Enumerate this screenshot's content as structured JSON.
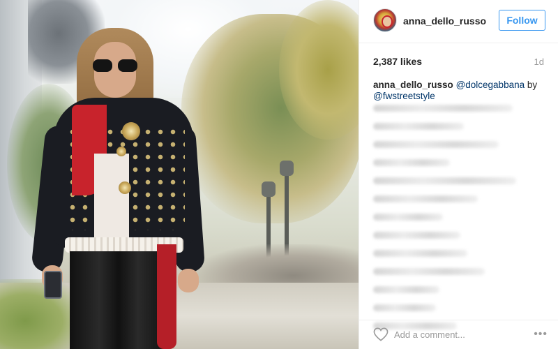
{
  "post": {
    "photo_description_icon": "post-photo",
    "author": {
      "username": "anna_dello_russo",
      "avatar_icon": "user-avatar"
    },
    "follow_label": "Follow",
    "likes_text": "2,387 likes",
    "age_text": "1d",
    "caption": {
      "username": "anna_dello_russo",
      "mention_1": "@dolcegabbana",
      "connector": "by",
      "mention_2": "@fwstreetstyle"
    },
    "comment_placeholder": "Add a comment...",
    "more_label": "•••",
    "colors": {
      "accent": "#3897f0",
      "text": "#262626",
      "muted": "#999999",
      "mention": "#003569",
      "border": "#efefef"
    }
  }
}
